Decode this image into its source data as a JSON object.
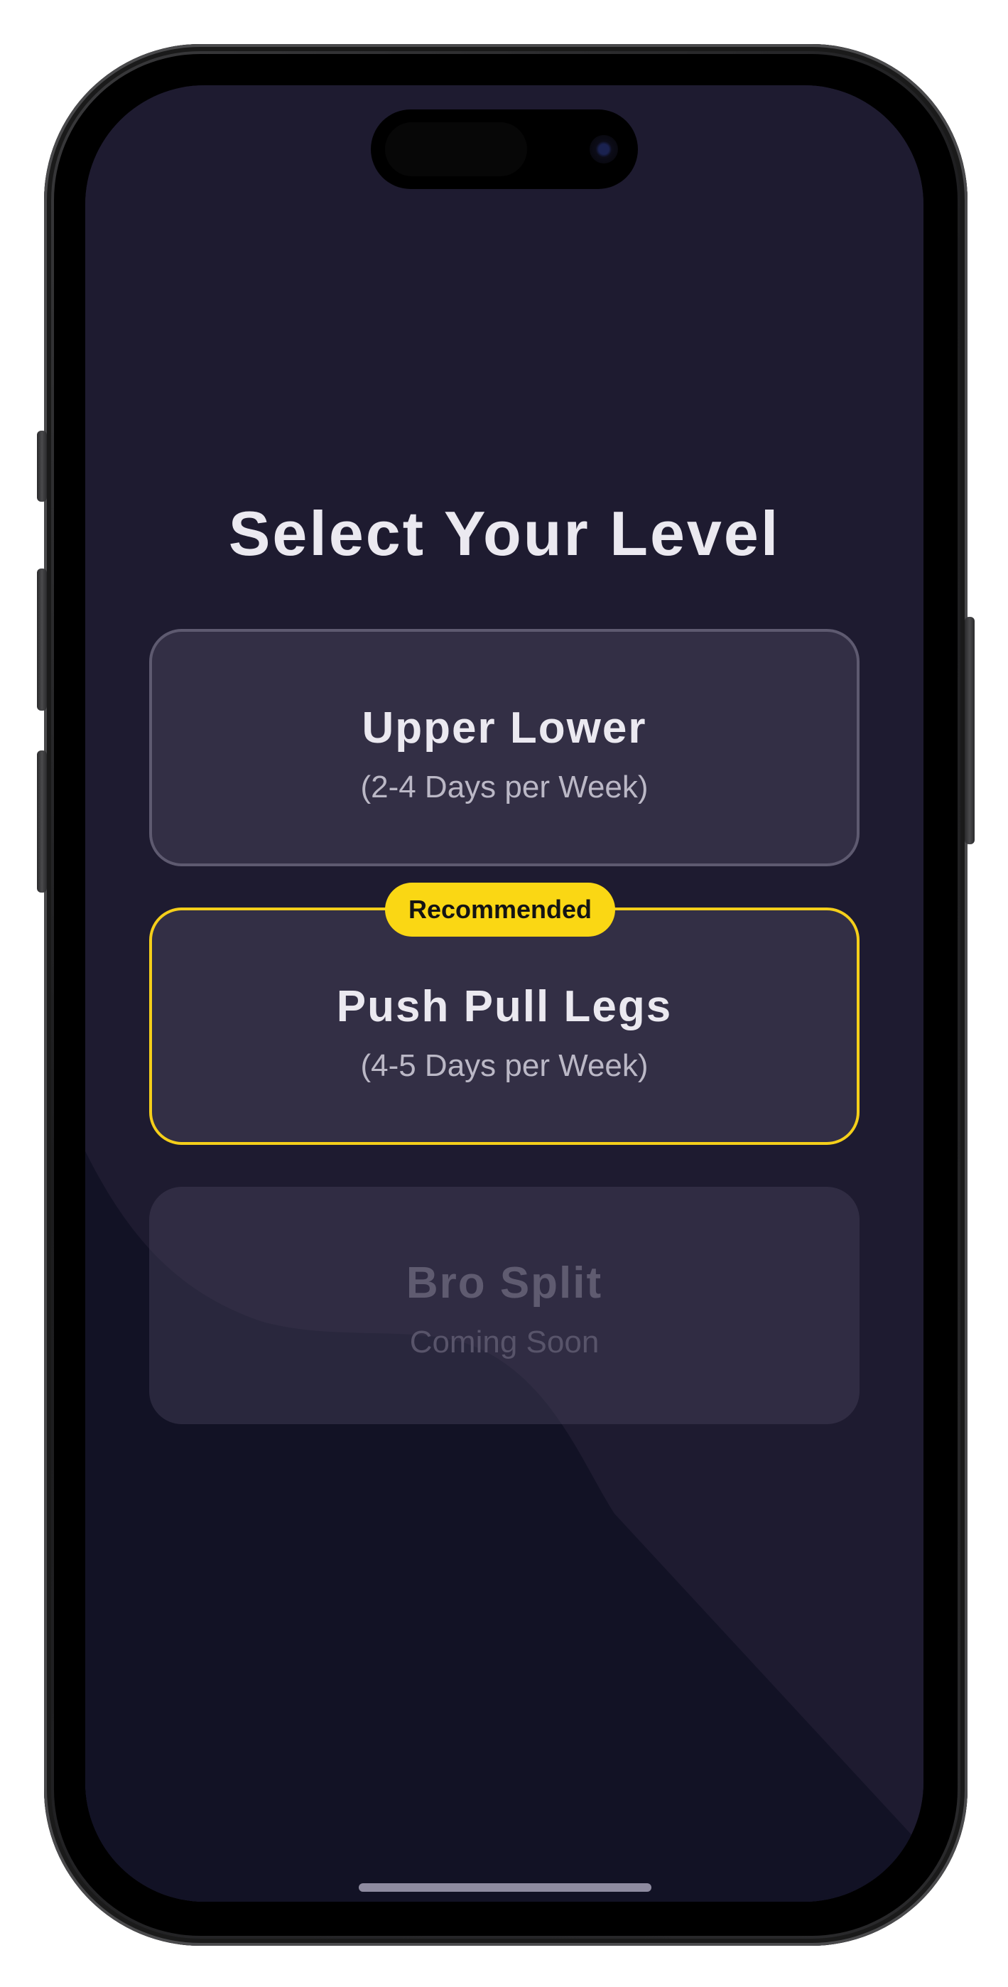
{
  "screen": {
    "title": "Select Your Level"
  },
  "plans": [
    {
      "title": "Upper Lower",
      "subtitle": "(2-4 Days per Week)",
      "state": "available"
    },
    {
      "title": "Push Pull Legs",
      "subtitle": "(4-5 Days per Week)",
      "state": "recommended",
      "badge": "Recommended"
    },
    {
      "title": "Bro Split",
      "subtitle": "Coming Soon",
      "state": "disabled"
    }
  ],
  "colors": {
    "background": "#1e1b30",
    "card": "#332f45",
    "accent": "#fad714",
    "text": "#ebe9f0"
  }
}
